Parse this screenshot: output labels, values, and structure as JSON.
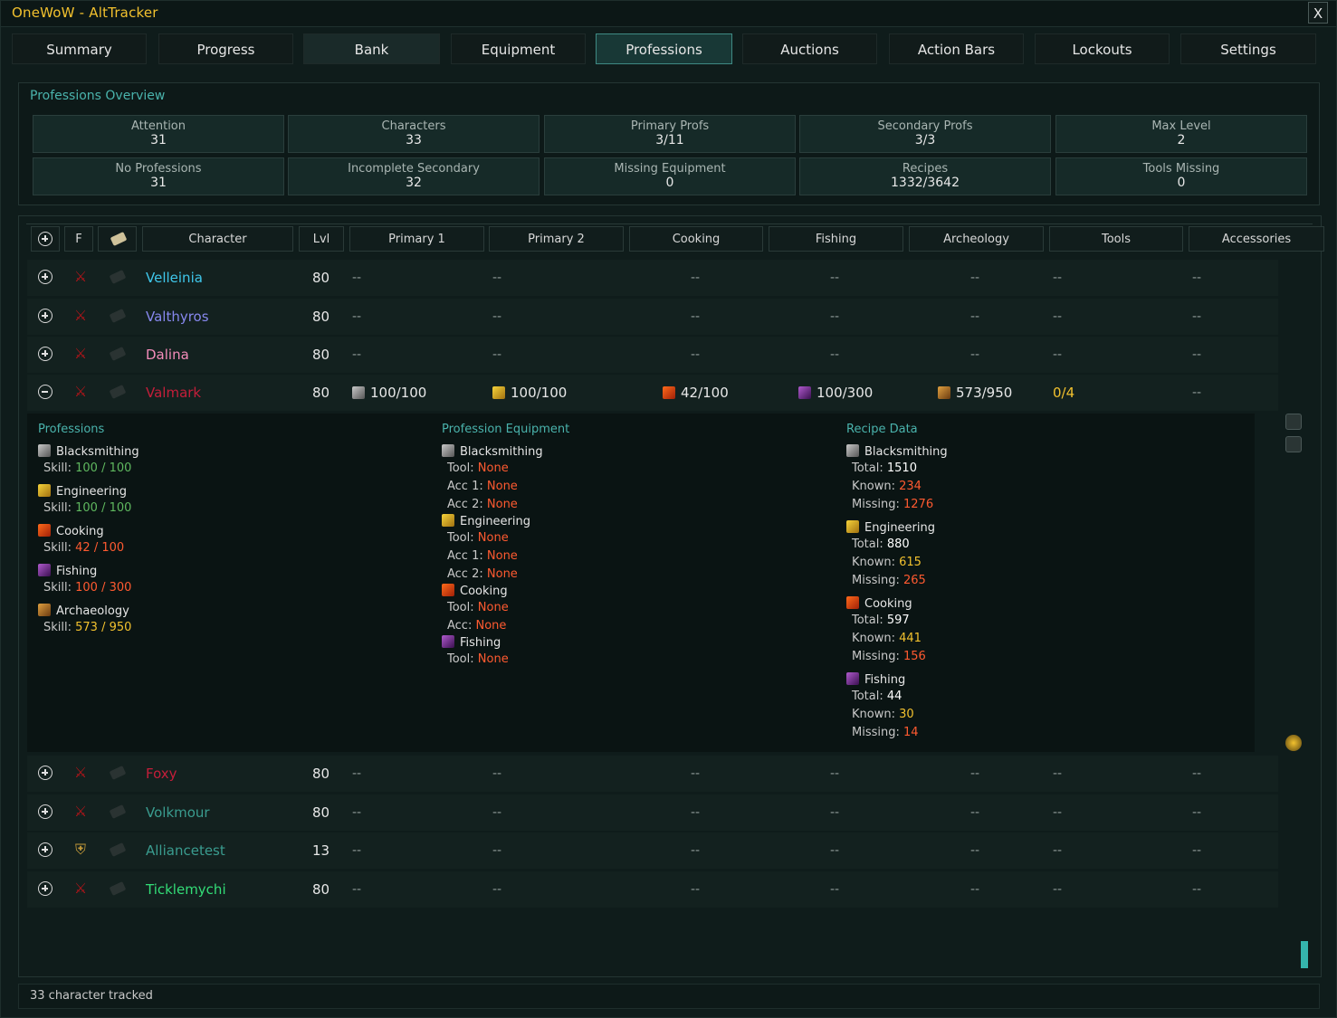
{
  "window": {
    "title": "OneWoW - AltTracker",
    "close_label": "X"
  },
  "tabs": [
    {
      "label": "Summary"
    },
    {
      "label": "Progress"
    },
    {
      "label": "Bank"
    },
    {
      "label": "Equipment"
    },
    {
      "label": "Professions"
    },
    {
      "label": "Auctions"
    },
    {
      "label": "Action Bars"
    },
    {
      "label": "Lockouts"
    },
    {
      "label": "Settings"
    }
  ],
  "active_tab": "Professions",
  "overview": {
    "title": "Professions Overview",
    "stats": [
      {
        "label": "Attention",
        "value": "31"
      },
      {
        "label": "Characters",
        "value": "33"
      },
      {
        "label": "Primary Profs",
        "value": "3/11"
      },
      {
        "label": "Secondary Profs",
        "value": "3/3"
      },
      {
        "label": "Max Level",
        "value": "2"
      },
      {
        "label": "No Professions",
        "value": "31"
      },
      {
        "label": "Incomplete Secondary",
        "value": "32"
      },
      {
        "label": "Missing Equipment",
        "value": "0"
      },
      {
        "label": "Recipes",
        "value": "1332/3642"
      },
      {
        "label": "Tools Missing",
        "value": "0"
      }
    ]
  },
  "table": {
    "headers": {
      "f": "F",
      "character": "Character",
      "lvl": "Lvl",
      "primary1": "Primary 1",
      "primary2": "Primary 2",
      "cooking": "Cooking",
      "fishing": "Fishing",
      "archeology": "Archeology",
      "tools": "Tools",
      "accessories": "Accessories"
    },
    "dash": "--",
    "rows": [
      {
        "name": "Velleinia",
        "level": "80",
        "color": "#3fc7eb"
      },
      {
        "name": "Valthyros",
        "level": "80",
        "color": "#8788ee"
      },
      {
        "name": "Dalina",
        "level": "80",
        "color": "#f48cba"
      },
      {
        "name": "Valmark",
        "level": "80",
        "color": "#c41e3a",
        "primary1": "100/100",
        "primary2": "100/100",
        "cooking": "42/100",
        "fishing": "100/300",
        "archeology": "573/950",
        "tools": "0/4"
      },
      {
        "name": "Foxy",
        "level": "80",
        "color": "#c41e3a"
      },
      {
        "name": "Volkmour",
        "level": "80",
        "color": "#3a9c8f"
      },
      {
        "name": "Alliancetest",
        "level": "13",
        "color": "#3a9c8f"
      },
      {
        "name": "Ticklemychi",
        "level": "80",
        "color": "#33dd77"
      }
    ]
  },
  "detail": {
    "professions": {
      "title": "Professions",
      "skill_label": "Skill:",
      "items": [
        {
          "name": "Blacksmithing",
          "skill": "100 / 100"
        },
        {
          "name": "Engineering",
          "skill": "100 / 100"
        },
        {
          "name": "Cooking",
          "skill": "42 / 100"
        },
        {
          "name": "Fishing",
          "skill": "100 / 300"
        },
        {
          "name": "Archaeology",
          "skill": "573 / 950"
        }
      ]
    },
    "equipment": {
      "title": "Profession Equipment",
      "tool_label": "Tool:",
      "acc1_label": "Acc 1:",
      "acc2_label": "Acc 2:",
      "acc_label": "Acc:",
      "none": "None",
      "items": [
        {
          "name": "Blacksmithing"
        },
        {
          "name": "Engineering"
        },
        {
          "name": "Cooking"
        },
        {
          "name": "Fishing"
        }
      ]
    },
    "recipes": {
      "title": "Recipe Data",
      "total_label": "Total:",
      "known_label": "Known:",
      "missing_label": "Missing:",
      "items": [
        {
          "name": "Blacksmithing",
          "total": "1510",
          "known": "234",
          "missing": "1276"
        },
        {
          "name": "Engineering",
          "total": "880",
          "known": "615",
          "missing": "265"
        },
        {
          "name": "Cooking",
          "total": "597",
          "known": "441",
          "missing": "156"
        },
        {
          "name": "Fishing",
          "total": "44",
          "known": "30",
          "missing": "14"
        }
      ]
    }
  },
  "status": {
    "text": "33 character tracked"
  },
  "colors": {
    "accent": "#4ab3ac",
    "title": "#f2c12e",
    "bad": "#ff5a30",
    "good": "#5fb85f",
    "warn": "#f2c12e"
  }
}
